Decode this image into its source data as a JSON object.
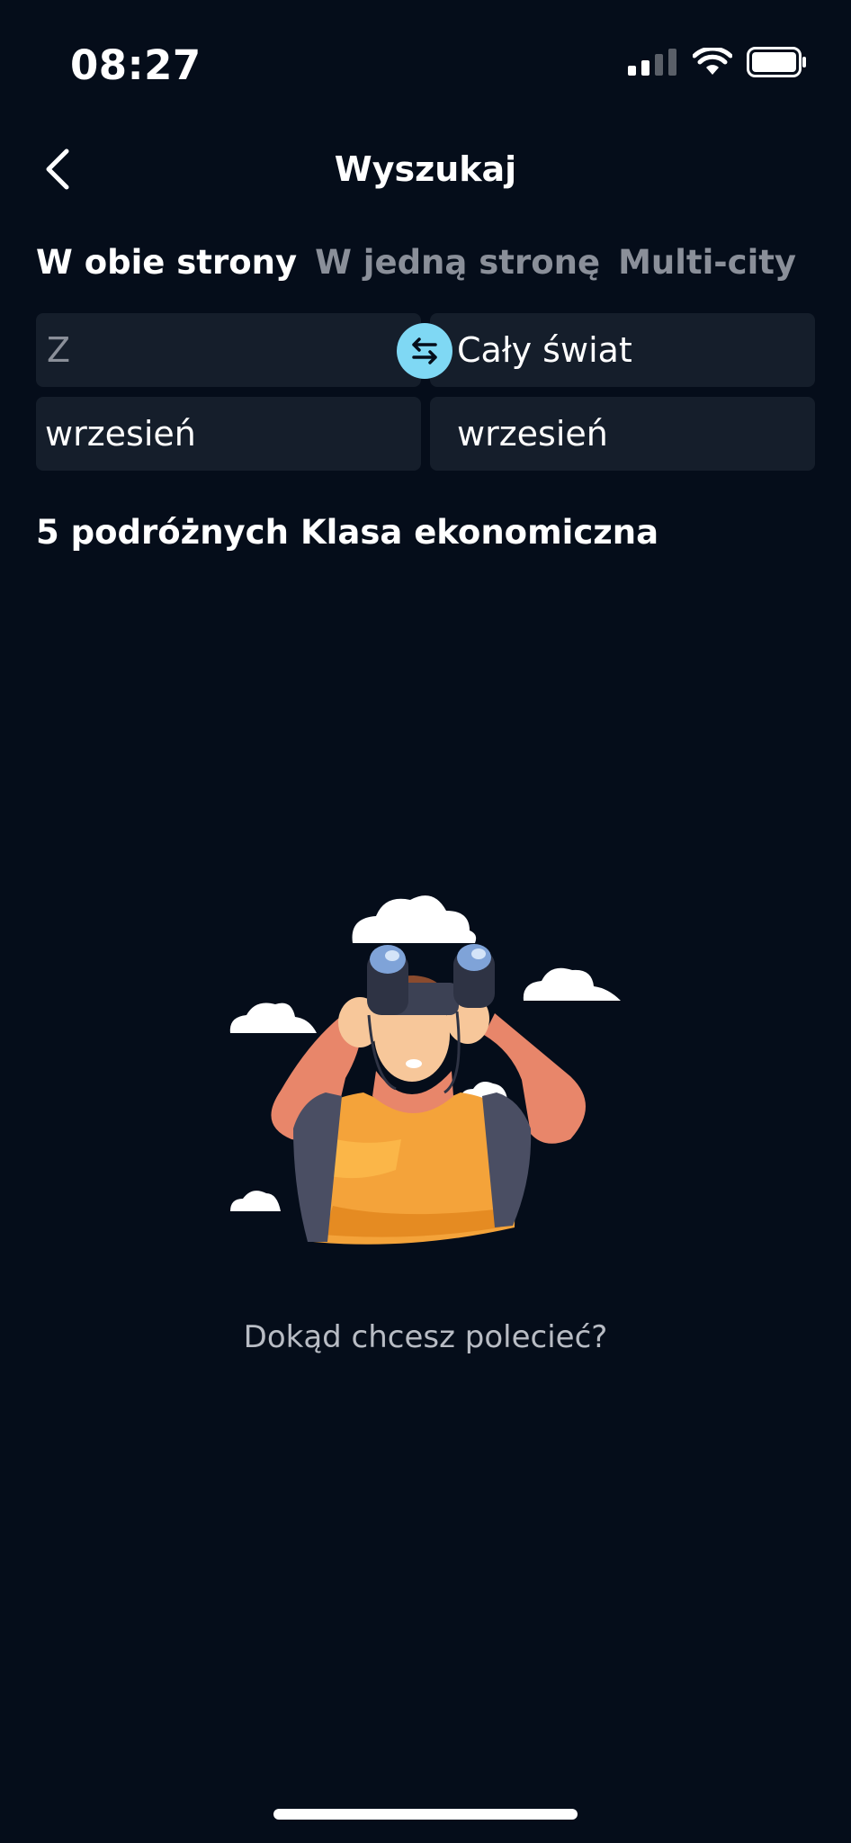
{
  "status_bar": {
    "time": "08:27",
    "icons": [
      "signal-icon",
      "wifi-icon",
      "battery-icon"
    ]
  },
  "header": {
    "title": "Wyszukaj",
    "back_icon": "chevron-left-icon"
  },
  "tabs": [
    {
      "label": "W obie strony",
      "active": true
    },
    {
      "label": "W jedną stronę",
      "active": false
    },
    {
      "label": "Multi-city",
      "active": false
    }
  ],
  "route": {
    "from_placeholder": "Z",
    "to_value": "Cały świat",
    "swap_icon": "swap-arrows-icon"
  },
  "dates": {
    "depart": "wrzesień",
    "return": "wrzesień"
  },
  "options": {
    "travellers": "5 podróżnych",
    "cabin_class": "Klasa ekonomiczna"
  },
  "empty_state": {
    "illustration": "person-with-binoculars-illustration",
    "message": "Dokąd chcesz polecieć?"
  },
  "colors": {
    "background": "#050d1a",
    "field": "#151e2b",
    "accent": "#7fd8f4",
    "inactive_text": "#8a8f99"
  }
}
